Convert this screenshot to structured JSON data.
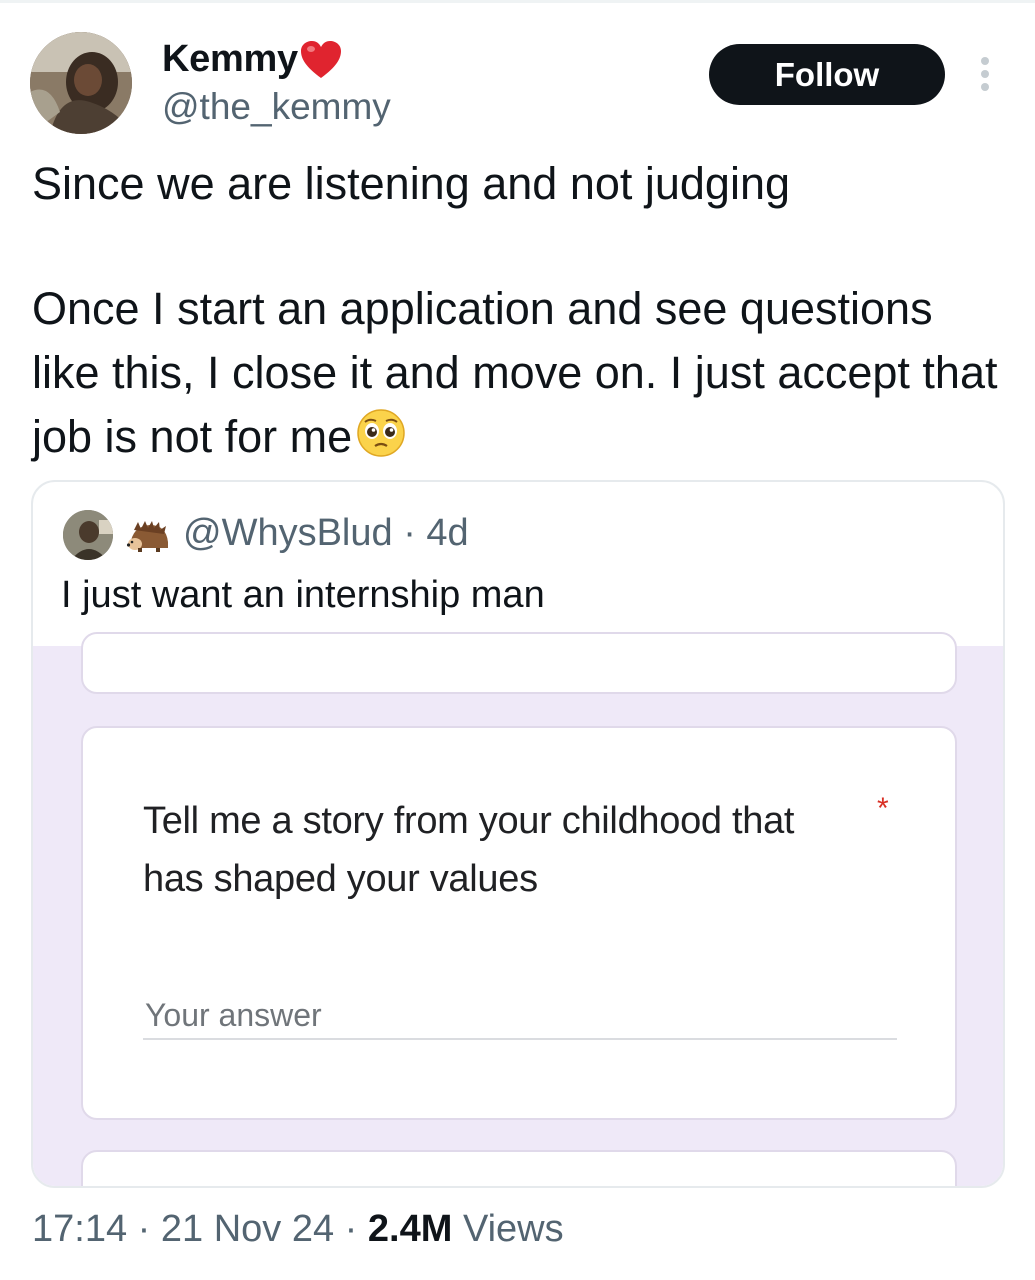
{
  "author": {
    "name": "Kemmy",
    "name_emoji": "heart-icon",
    "handle": "@the_kemmy",
    "avatar": "avatar"
  },
  "follow_label": "Follow",
  "more_icon": "more-vertical-icon",
  "tweet": {
    "paragraph_1": "Since we are listening and not judging",
    "paragraph_2": "Once I start an application and see questions like this, I close it and move on. I just accept that job is not for me",
    "emoji": "pleading-face-icon"
  },
  "quote": {
    "icon": "hedgehog-icon",
    "meta": "@WhysBlud · 4d",
    "text": "I just want an internship man",
    "form": {
      "question": "Tell me a story from your childhood that has shaped your values",
      "required_mark": "*",
      "answer_placeholder": "Your answer",
      "background_color": "#efe9f8"
    }
  },
  "footer": {
    "time": "17:14",
    "separator": "·",
    "date": "21 Nov 24",
    "views_count": "2.4M",
    "views_label": "Views"
  },
  "colors": {
    "text_primary": "#0f1419",
    "text_secondary": "#536471",
    "follow_bg": "#0f1419",
    "required": "#d93025"
  }
}
